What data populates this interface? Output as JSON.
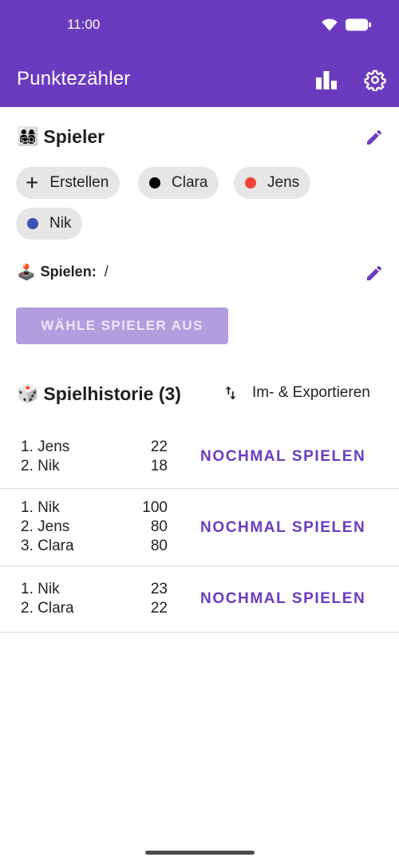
{
  "status": {
    "time": "11:00"
  },
  "appbar": {
    "title": "Punktezähler",
    "stats_icon": "bar-chart-icon",
    "settings_icon": "gear-icon"
  },
  "colors": {
    "primary": "#6b3bbf",
    "button_disabled": "#b49ddf"
  },
  "players_section": {
    "emoji": "👨‍👩‍👧‍👦",
    "title": "Spieler",
    "create_label": "Erstellen",
    "players": [
      {
        "name": "Clara",
        "color": "#000000"
      },
      {
        "name": "Jens",
        "color": "#f44336"
      },
      {
        "name": "Nik",
        "color": "#3f51b5"
      }
    ]
  },
  "play": {
    "emoji": "🕹️",
    "label": "Spielen:",
    "value": "/"
  },
  "select_button": "WÄHLE SPIELER AUS",
  "history": {
    "emoji": "🎲",
    "title": "Spielhistorie (3)",
    "export_label": "Im- & Exportieren",
    "play_again_label": "NOCHMAL SPIELEN",
    "games": [
      {
        "entries": [
          {
            "rank": "1. Jens",
            "score": "22"
          },
          {
            "rank": "2. Nik",
            "score": "18"
          }
        ]
      },
      {
        "entries": [
          {
            "rank": "1. Nik",
            "score": "100"
          },
          {
            "rank": "2. Jens",
            "score": "80"
          },
          {
            "rank": "3. Clara",
            "score": "80"
          }
        ]
      },
      {
        "entries": [
          {
            "rank": "1. Nik",
            "score": "23"
          },
          {
            "rank": "2. Clara",
            "score": "22"
          }
        ]
      }
    ]
  }
}
